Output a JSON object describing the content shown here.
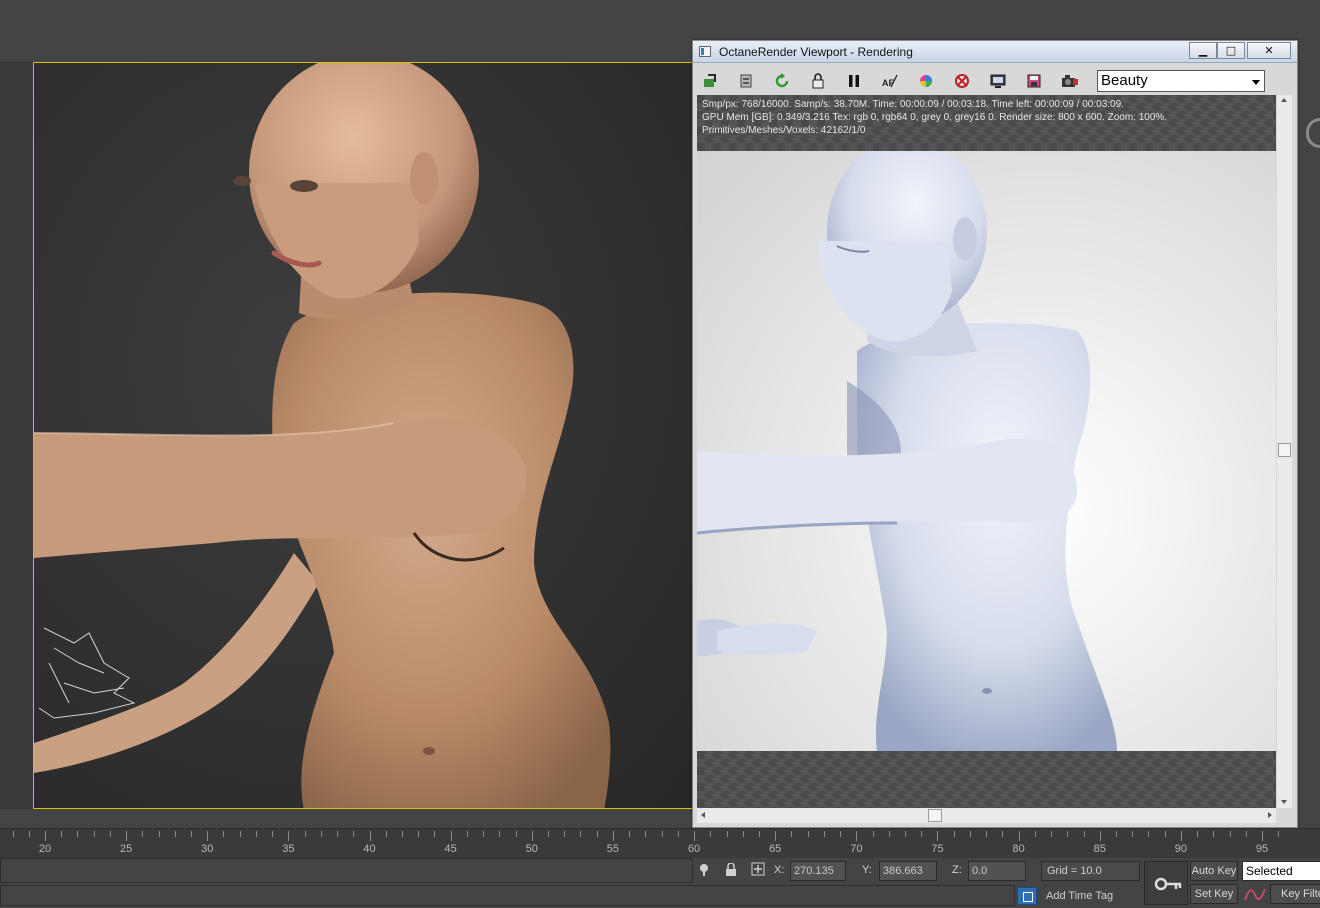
{
  "octane_window": {
    "title": "OctaneRender Viewport - Rendering",
    "buttons": {
      "minimize": "▁",
      "maximize": "□",
      "close": "✕"
    },
    "toolbar_icons": [
      "send-scene-icon",
      "clipboard-icon",
      "restart-render-icon",
      "lock-icon",
      "pause-icon",
      "af-focus-icon",
      "color-picker-icon",
      "clay-mode-icon",
      "region-render-icon",
      "save-image-icon",
      "camera-icon"
    ],
    "pass_select": {
      "value": "Beauty"
    },
    "stats": {
      "line1": "Smp/px: 768/16000.   Samp/s: 38.70M.   Time: 00:00:09 / 00:03:18.   Time left: 00:00:09 / 00:03:09.",
      "line2": "GPU Mem [GB]: 0.349/3.216   Tex: rgb 0, rgb64 0, grey 0, grey16 0.   Render size: 800 x 600.   Zoom: 100%.",
      "line3": "Primitives/Meshes/Voxels: 42162/1/0"
    }
  },
  "timeline": {
    "ticks": [
      "20",
      "25",
      "30",
      "35",
      "40",
      "45",
      "50",
      "55",
      "60",
      "65",
      "70",
      "75",
      "80",
      "85",
      "90",
      "95"
    ]
  },
  "status_bar": {
    "x_label": "X:",
    "x_value": "270.135",
    "y_label": "Y:",
    "y_value": "386.663",
    "z_label": "Z:",
    "z_value": "0.0",
    "grid": "Grid = 10.0",
    "add_time_tag": "Add Time Tag",
    "auto_key": "Auto Key",
    "set_key": "Set Key",
    "selected": "Selected",
    "key_filters": "Key Filters..."
  },
  "colors": {
    "viewport_border": "#d8c200",
    "skin": "#c89f80",
    "clay": "#dfe3ef"
  }
}
